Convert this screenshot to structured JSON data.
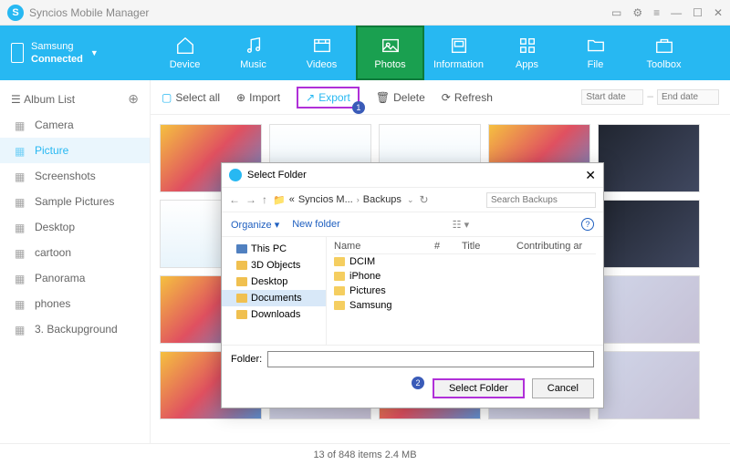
{
  "app": {
    "title": "Syncios Mobile Manager"
  },
  "device": {
    "name": "Samsung",
    "status": "Connected"
  },
  "nav": {
    "device": "Device",
    "music": "Music",
    "videos": "Videos",
    "photos": "Photos",
    "information": "Information",
    "apps": "Apps",
    "file": "File",
    "toolbox": "Toolbox"
  },
  "sidebar": {
    "header": "Album List",
    "items": [
      "Camera",
      "Picture",
      "Screenshots",
      "Sample Pictures",
      "Desktop",
      "cartoon",
      "Panorama",
      "phones",
      "3. Backupground"
    ],
    "selected_index": 1
  },
  "actions": {
    "select_all": "Select all",
    "import": "Import",
    "export": "Export",
    "delete": "Delete",
    "refresh": "Refresh",
    "start_date": "Start date",
    "end_date": "End date",
    "export_step": "1"
  },
  "status": "13 of 848 items 2.4 MB",
  "dialog": {
    "title": "Select Folder",
    "breadcrumb": [
      "Syncios M...",
      "Backups"
    ],
    "search_placeholder": "Search Backups",
    "organize": "Organize",
    "new_folder": "New folder",
    "tree": [
      "This PC",
      "3D Objects",
      "Desktop",
      "Documents",
      "Downloads"
    ],
    "tree_selected_index": 3,
    "columns": [
      "Name",
      "#",
      "Title",
      "Contributing ar"
    ],
    "folders": [
      "DCIM",
      "iPhone",
      "Pictures",
      "Samsung"
    ],
    "folder_label": "Folder:",
    "folder_value": "",
    "select_btn": "Select Folder",
    "cancel_btn": "Cancel",
    "select_step": "2"
  }
}
